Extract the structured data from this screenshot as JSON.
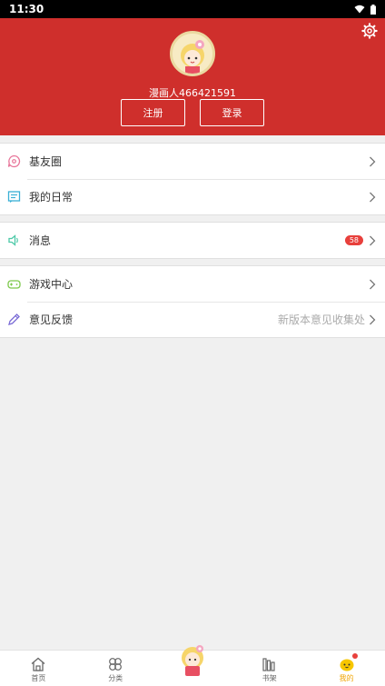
{
  "status": {
    "time": "11:30"
  },
  "profile": {
    "username": "漫画人466421591",
    "register_label": "注册",
    "login_label": "登录"
  },
  "menu": {
    "group1": [
      {
        "label": "基友圈",
        "icon": "chat-bubble-icon"
      },
      {
        "label": "我的日常",
        "icon": "notebook-icon"
      }
    ],
    "messages": {
      "label": "消息",
      "badge": "58",
      "icon": "speaker-icon"
    },
    "group3": [
      {
        "label": "游戏中心",
        "icon": "gamepad-icon"
      },
      {
        "label": "意见反馈",
        "right_text": "新版本意见收集处",
        "icon": "pencil-icon"
      }
    ]
  },
  "tabbar": {
    "home": "首页",
    "category": "分类",
    "bookshelf": "书架",
    "mine": "我的"
  },
  "colors": {
    "brand": "#cf2f2c",
    "active_tab": "#f0a400"
  }
}
